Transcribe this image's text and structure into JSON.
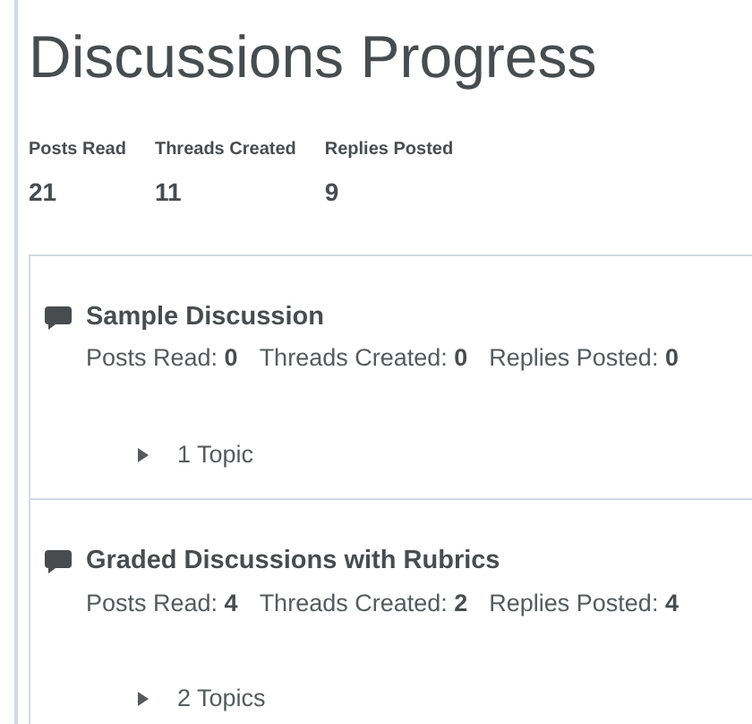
{
  "title": "Discussions Progress",
  "summary": [
    {
      "label": "Posts Read",
      "value": "21"
    },
    {
      "label": "Threads Created",
      "value": "11"
    },
    {
      "label": "Replies Posted",
      "value": "9"
    }
  ],
  "forums": [
    {
      "name": "Sample Discussion",
      "stats": [
        "Posts Read: **0**",
        "Threads Created: **0**",
        "Replies Posted: **0**"
      ],
      "topics": "1 Topic",
      "expanded": false
    },
    {
      "name": "Graded Discussions with Rubrics",
      "stats": [
        "Posts Read: **4**",
        "Threads Created: **2**",
        "Replies Posted: **4**"
      ],
      "topics": "2 Topics",
      "expanded": false
    }
  ]
}
